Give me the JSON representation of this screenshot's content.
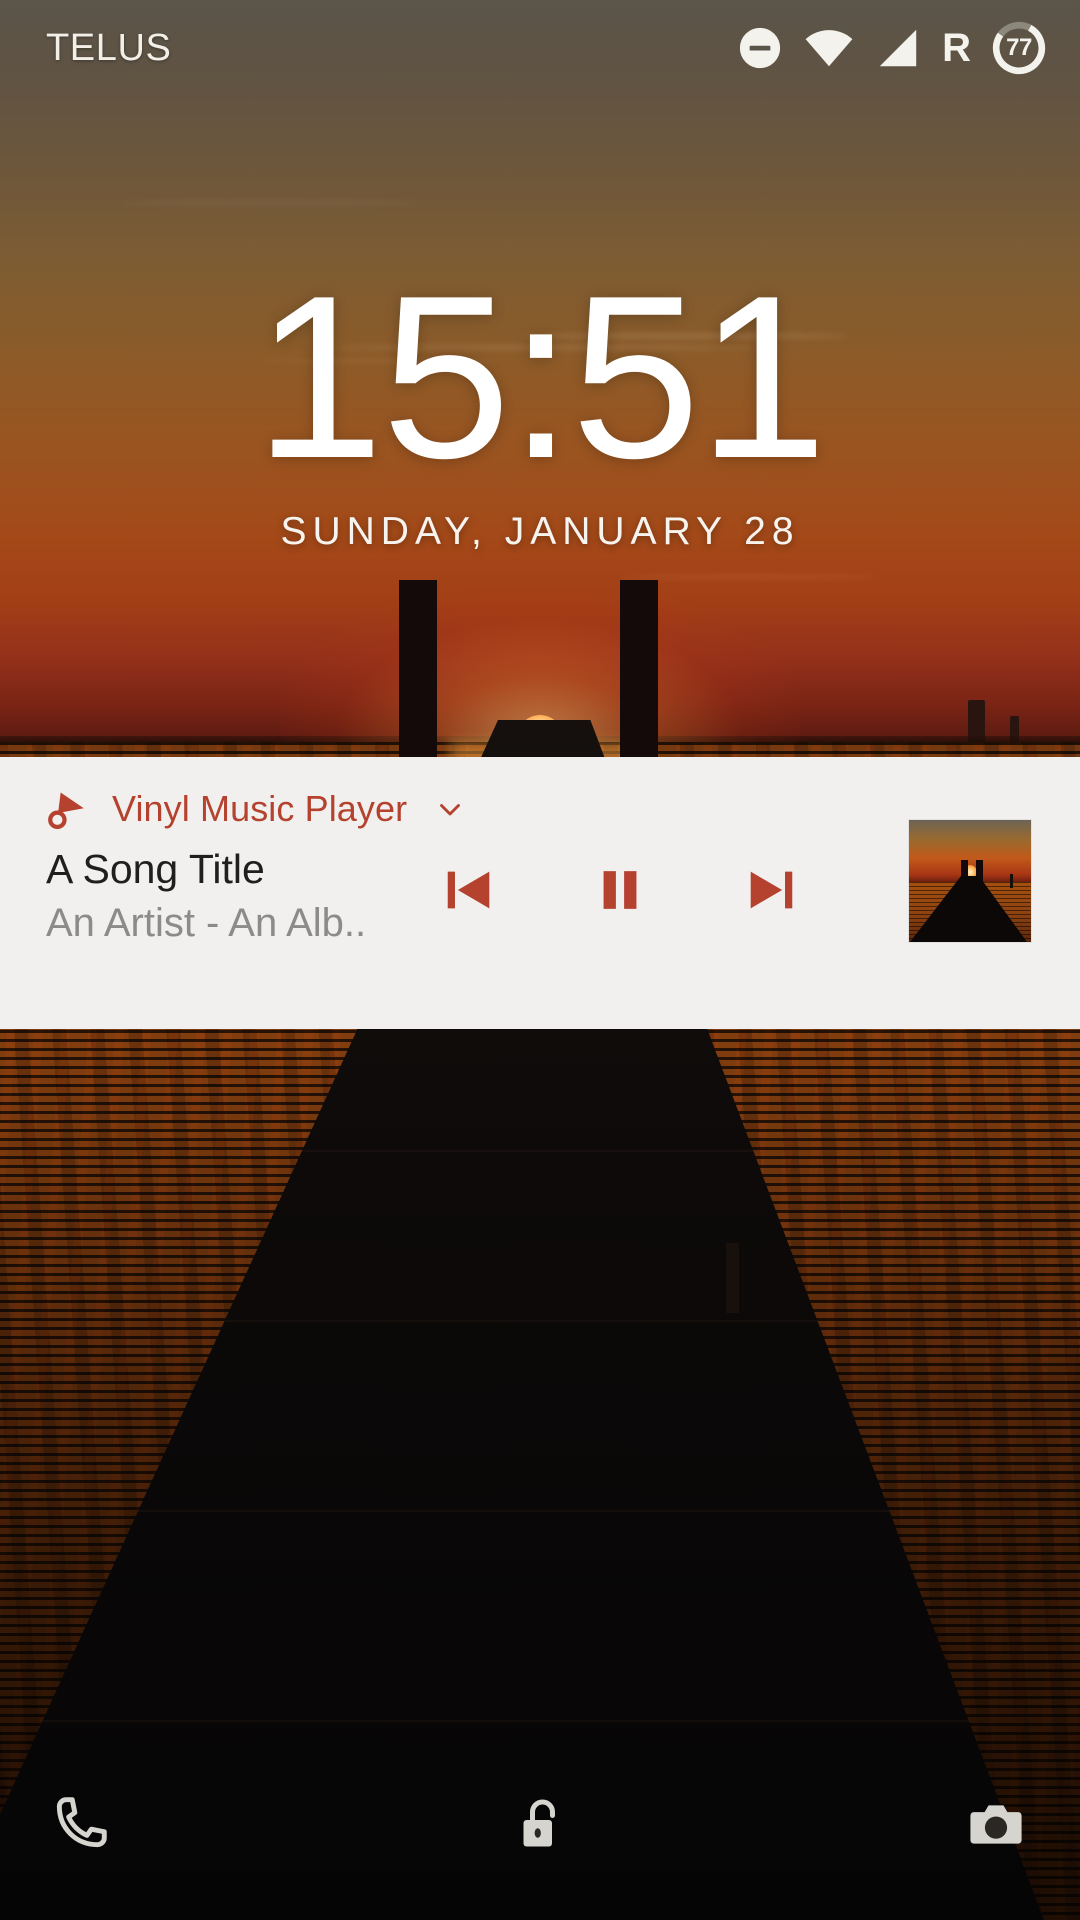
{
  "status_bar": {
    "carrier": "TELUS",
    "battery_percent": "77",
    "icons": [
      {
        "name": "do-not-disturb-icon",
        "label": "Do Not Disturb"
      },
      {
        "name": "wifi-icon",
        "label": "Wi-Fi"
      },
      {
        "name": "cellular-signal-icon",
        "label": "Cellular signal"
      },
      {
        "name": "roaming-indicator",
        "label": "R"
      },
      {
        "name": "battery-circle-icon",
        "label": "Battery 77%"
      }
    ],
    "roaming_letter": "R"
  },
  "lock_screen": {
    "time": "15:51",
    "date": "SUNDAY, JANUARY 28"
  },
  "notification": {
    "app_name": "Vinyl Music Player",
    "app_icon": "tonearm-icon",
    "expand_icon": "chevron-down-icon",
    "track_title": "A Song Title",
    "track_subtitle": "An Artist - An Alb..",
    "album_art_label": "Album art",
    "controls": [
      {
        "name": "previous-button",
        "label": "Previous"
      },
      {
        "name": "pause-button",
        "label": "Pause"
      },
      {
        "name": "next-button",
        "label": "Next"
      }
    ],
    "accent_color": "#b5422f",
    "background_color": "#f1f0ee"
  },
  "bottom_shortcuts": [
    {
      "name": "phone-shortcut",
      "label": "Phone",
      "icon": "phone-icon"
    },
    {
      "name": "unlock-indicator",
      "label": "Unlock",
      "icon": "unlock-icon"
    },
    {
      "name": "camera-shortcut",
      "label": "Camera",
      "icon": "camera-icon"
    }
  ],
  "wallpaper": {
    "description": "Sunset over water with silhouetted pier"
  }
}
